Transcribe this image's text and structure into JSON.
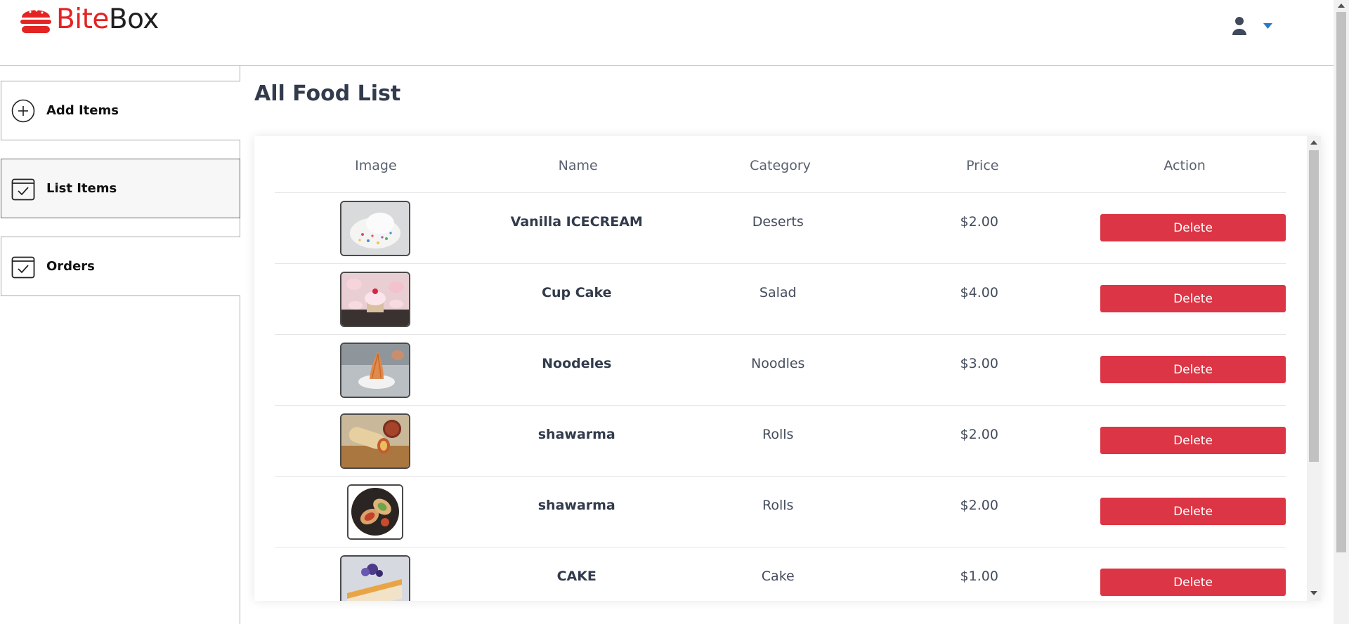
{
  "app": {
    "name_part1": "Bite",
    "name_part2": "Box",
    "brand_color": "#e42323",
    "logo_icon": "burger-icon"
  },
  "header": {
    "profile_icon": "user-icon",
    "dropdown_icon": "caret-down-icon",
    "accent_color": "#2b78c5"
  },
  "sidebar": {
    "items": [
      {
        "label": "Add Items",
        "icon": "plus-circle-icon",
        "active": false
      },
      {
        "label": "List Items",
        "icon": "checkbox-icon",
        "active": true
      },
      {
        "label": "Orders",
        "icon": "checkbox-icon",
        "active": false
      }
    ]
  },
  "main": {
    "title": "All Food List",
    "table": {
      "columns": [
        "Image",
        "Name",
        "Category",
        "Price",
        "Action"
      ],
      "rows": [
        {
          "image": "ice-cream-image",
          "name": "Vanilla ICECREAM",
          "category": "Deserts",
          "price": "$2.00",
          "action": "Delete"
        },
        {
          "image": "cupcake-image",
          "name": "Cup Cake",
          "category": "Salad",
          "price": "$4.00",
          "action": "Delete"
        },
        {
          "image": "noodles-image",
          "name": "Noodeles",
          "category": "Noodles",
          "price": "$3.00",
          "action": "Delete"
        },
        {
          "image": "shawarma-image",
          "name": "shawarma",
          "category": "Rolls",
          "price": "$2.00",
          "action": "Delete"
        },
        {
          "image": "shawarma-round-image",
          "name": "shawarma",
          "category": "Rolls",
          "price": "$2.00",
          "action": "Delete"
        },
        {
          "image": "cake-image",
          "name": "CAKE",
          "category": "Cake",
          "price": "$1.00",
          "action": "Delete"
        }
      ]
    },
    "delete_color": "#dc3545"
  }
}
